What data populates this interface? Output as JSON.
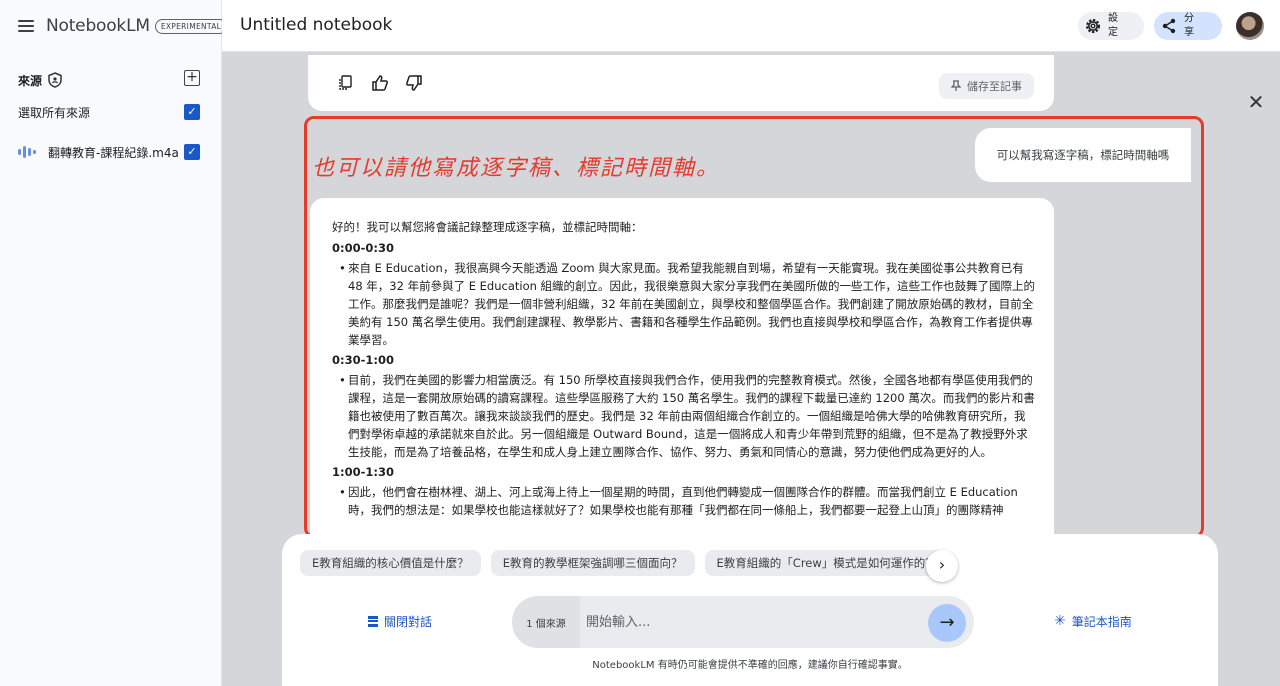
{
  "app": {
    "name": "NotebookLM",
    "badge": "EXPERIMENTAL"
  },
  "sidebar": {
    "sources_title": "來源",
    "select_all_label": "選取所有來源",
    "items": [
      {
        "label": "翻轉教育-課程紀錄.m4a",
        "icon": "audio-waveform-icon",
        "checked": true
      }
    ]
  },
  "header": {
    "notebook_title": "Untitled notebook",
    "settings_label": "設定",
    "share_label": "分享"
  },
  "previous_message": {
    "save_note_label": "儲存至記事"
  },
  "annotation": {
    "text": "也可以請他寫成逐字稿、標記時間軸。",
    "color": "#e53b2b"
  },
  "chat": {
    "user_message": "可以幫我寫逐字稿，標記時間軸嗎",
    "response": {
      "intro": "好的！我可以幫您將會議記錄整理成逐字稿，並標記時間軸：",
      "sections": [
        {
          "timestamp": "0:00-0:30",
          "text": "來自 E Education，我很高興今天能透過 Zoom 與大家見面。我希望我能親自到場，希望有一天能實現。我在美國從事公共教育已有 48 年，32 年前參與了 E Education 組織的創立。因此，我很樂意與大家分享我們在美國所做的一些工作，這些工作也鼓舞了國際上的工作。那麼我們是誰呢？我們是一個非營利組織，32 年前在美國創立，與學校和整個學區合作。我們創建了開放原始碼的教材，目前全美約有 150 萬名學生使用。我們創建課程、教學影片、書籍和各種學生作品範例。我們也直接與學校和學區合作，為教育工作者提供專業學習。"
        },
        {
          "timestamp": "0:30-1:00",
          "text": "目前，我們在美國的影響力相當廣泛。有 150 所學校直接與我們合作，使用我們的完整教育模式。然後，全國各地都有學區使用我們的課程，這是一套開放原始碼的讀寫課程。這些學區服務了大約 150 萬名學生。我們的課程下載量已達約 1200 萬次。而我們的影片和書籍也被使用了數百萬次。讓我來談談我們的歷史。我們是 32 年前由兩個組織合作創立的。一個組織是哈佛大學的哈佛教育研究所，我們對學術卓越的承諾就來自於此。另一個組織是 Outward Bound，這是一個將成人和青少年帶到荒野的組織，但不是為了教授野外求生技能，而是為了培養品格，在學生和成人身上建立團隊合作、協作、努力、勇氣和同情心的意識，努力使他們成為更好的人。"
        },
        {
          "timestamp": "1:00-1:30",
          "text": "因此，他們會在樹林裡、湖上、河上或海上待上一個星期的時間，直到他們轉變成一個團隊合作的群體。而當我們創立 E Education 時，我們的想法是：如果學校也能這樣就好了？如果學校也能有那種「我們都在同一條船上，我們都要一起登上山頂」的團隊精神"
        }
      ]
    }
  },
  "suggestions": [
    "E教育組織的核心價值是什麼？",
    "E教育的教學框架強調哪三個面向？",
    "E教育組織的「Crew」模式是如何運作的？"
  ],
  "composer": {
    "close_chat_label": "關閉對話",
    "source_count_label": "1 個來源",
    "placeholder": "開始輸入...",
    "guide_label": "筆記本指南",
    "disclaimer": "NotebookLM 有時仍可能會提供不準確的回應，建議你自行確認事實。"
  },
  "colors": {
    "accent": "#1a57c9",
    "send_button": "#a8c7fa",
    "share_button": "#d3e3fd"
  }
}
